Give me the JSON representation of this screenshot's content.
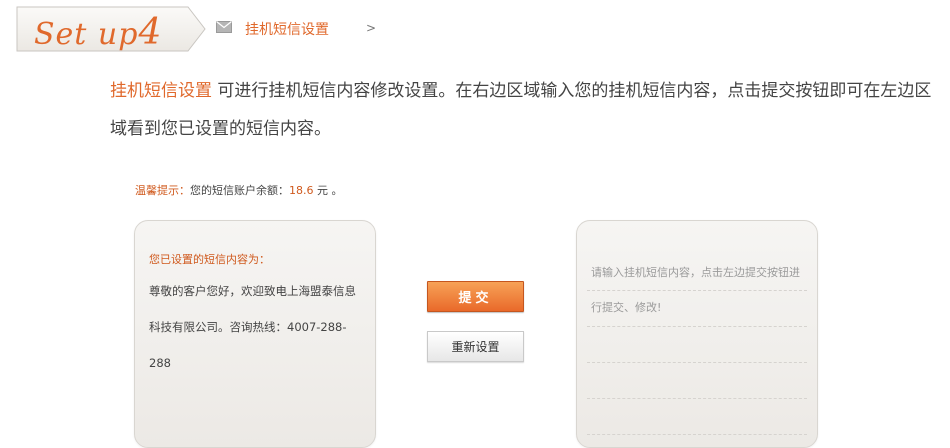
{
  "header": {
    "step_text": "Set up",
    "step_number": "4",
    "breadcrumb": "挂机短信设置",
    "breadcrumb_sep": ">"
  },
  "intro": {
    "highlight": "挂机短信设置",
    "text": " 可进行挂机短信内容修改设置。在右边区域输入您的挂机短信内容，点击提交按钮即可在左边区域看到您已设置的短信内容。"
  },
  "tip": {
    "label": "温馨提示：",
    "text": "您的短信账户余额：",
    "amount": "18.6",
    "suffix": " 元 。"
  },
  "left_panel": {
    "title": "您已设置的短信内容为：",
    "content": "尊敬的客户您好，欢迎致电上海盟泰信息科技有限公司。咨询热线：4007-288-288"
  },
  "right_panel": {
    "placeholder": "请输入挂机短信内容，点击左边提交按钮进行提交、修改!"
  },
  "buttons": {
    "submit": "提交",
    "reset": "重新设置"
  },
  "colors": {
    "accent": "#e0692c",
    "button_orange": "#ef7c37"
  },
  "icons": [
    "mail-icon"
  ]
}
